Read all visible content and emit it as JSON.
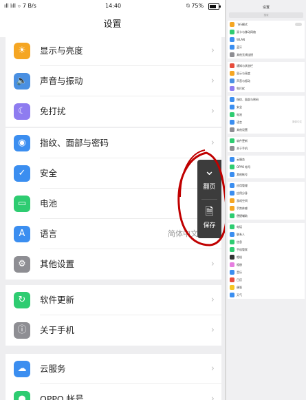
{
  "status_bar": {
    "left": "ıll 𝄁ıll ⌔ 7 B/s",
    "time": "14:40",
    "right": "⍉ 75%"
  },
  "nav": {
    "title": "设置"
  },
  "groups": [
    {
      "items": [
        {
          "label": "显示与亮度",
          "icon": "sun-icon",
          "glyph": "☀",
          "color": "#f5a623",
          "chevron": "›"
        },
        {
          "label": "声音与振动",
          "icon": "speaker-icon",
          "glyph": "🔈",
          "color": "#4a90e2",
          "chevron": "›"
        },
        {
          "label": "免打扰",
          "icon": "moon-icon",
          "glyph": "☾",
          "color": "#8e7cf0",
          "chevron": "›"
        }
      ]
    },
    {
      "items": [
        {
          "label": "指纹、面部与密码",
          "icon": "fingerprint-icon",
          "glyph": "◉",
          "color": "#3b8ef0",
          "chevron": "›"
        },
        {
          "label": "安全",
          "icon": "shield-icon",
          "glyph": "✓",
          "color": "#3b8ef0",
          "chevron": "›"
        },
        {
          "label": "电池",
          "icon": "battery-icon",
          "glyph": "▭",
          "color": "#2ecc71",
          "chevron": "›"
        },
        {
          "label": "语言",
          "icon": "language-icon",
          "glyph": "A",
          "color": "#3b8ef0",
          "value": "简体中文",
          "chevron": "›"
        },
        {
          "label": "其他设置",
          "icon": "gear-icon",
          "glyph": "⚙",
          "color": "#8e8e93",
          "chevron": "›"
        }
      ]
    },
    {
      "items": [
        {
          "label": "软件更新",
          "icon": "update-icon",
          "glyph": "↻",
          "color": "#2ecc71",
          "chevron": "›"
        },
        {
          "label": "关于手机",
          "icon": "info-icon",
          "glyph": "ⓘ",
          "color": "#8e8e93",
          "chevron": "›"
        }
      ]
    },
    {
      "items": [
        {
          "label": "云服务",
          "icon": "cloud-icon",
          "glyph": "☁",
          "color": "#3b8ef0",
          "chevron": "›"
        },
        {
          "label": "OPPO 帐号",
          "icon": "account-icon",
          "glyph": "●",
          "color": "#2ecc71",
          "chevron": "›"
        }
      ]
    }
  ],
  "floating_menu": {
    "items": [
      {
        "label": "翻页",
        "icon": "chevron-down-icon",
        "glyph": "⌄"
      },
      {
        "label": "保存",
        "icon": "save-icon",
        "glyph": "▯"
      }
    ]
  },
  "preview": {
    "status": "",
    "title": "设置",
    "search": "搜索",
    "groups": [
      {
        "items": [
          {
            "label": "飞行模式",
            "color": "#f5a623",
            "toggle": true
          },
          {
            "label": "双卡与移动网络",
            "color": "#2ecc71"
          },
          {
            "label": "WLAN",
            "color": "#3b8ef0"
          },
          {
            "label": "蓝牙",
            "color": "#3b8ef0"
          },
          {
            "label": "其他无线连接",
            "color": "#8e8e93"
          }
        ]
      },
      {
        "items": [
          {
            "label": "通知与状态栏",
            "color": "#e74c3c"
          },
          {
            "label": "显示与亮度",
            "color": "#f5a623"
          },
          {
            "label": "声音与振动",
            "color": "#4a90e2"
          },
          {
            "label": "免打扰",
            "color": "#8e7cf0"
          }
        ]
      },
      {
        "items": [
          {
            "label": "指纹、面部与密码",
            "color": "#3b8ef0"
          },
          {
            "label": "安全",
            "color": "#3b8ef0"
          },
          {
            "label": "电池",
            "color": "#2ecc71"
          },
          {
            "label": "语言",
            "color": "#3b8ef0",
            "value": "简体中文"
          },
          {
            "label": "其他设置",
            "color": "#8e8e93"
          }
        ]
      },
      {
        "items": [
          {
            "label": "软件更新",
            "color": "#2ecc71"
          },
          {
            "label": "关于手机",
            "color": "#8e8e93"
          }
        ]
      },
      {
        "items": [
          {
            "label": "云服务",
            "color": "#3b8ef0"
          },
          {
            "label": "OPPO 帐号",
            "color": "#2ecc71"
          },
          {
            "label": "其他帐号",
            "color": "#3b8ef0"
          }
        ]
      },
      {
        "items": [
          {
            "label": "应用管理",
            "color": "#3b8ef0"
          },
          {
            "label": "应用分身",
            "color": "#3b8ef0"
          },
          {
            "label": "游戏空间",
            "color": "#f5a623"
          },
          {
            "label": "手势体感",
            "color": "#f5a623"
          },
          {
            "label": "便捷辅助",
            "color": "#2ecc71"
          }
        ]
      },
      {
        "items": [
          {
            "label": "电话",
            "color": "#2ecc71"
          },
          {
            "label": "联系人",
            "color": "#3b8ef0"
          },
          {
            "label": "信息",
            "color": "#2ecc71"
          },
          {
            "label": "手机管家",
            "color": "#2ecc71"
          },
          {
            "label": "相机",
            "color": "#333333"
          },
          {
            "label": "相册",
            "color": "#e67ee0"
          },
          {
            "label": "音乐",
            "color": "#3b8ef0"
          },
          {
            "label": "日历",
            "color": "#e74c3c"
          },
          {
            "label": "便签",
            "color": "#f5c623"
          },
          {
            "label": "天气",
            "color": "#3b8ef0"
          }
        ]
      }
    ]
  }
}
